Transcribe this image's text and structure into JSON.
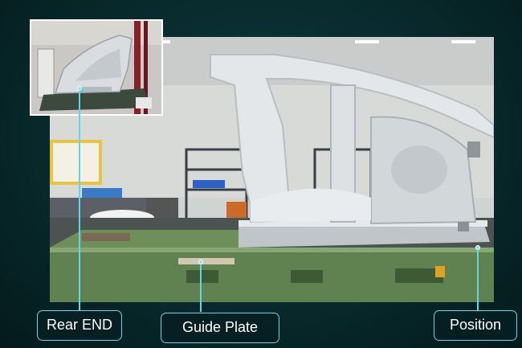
{
  "callouts": [
    {
      "label": "Rear END"
    },
    {
      "label": "Guide Plate"
    },
    {
      "label": "Position"
    }
  ],
  "colors": {
    "accent": "#5fd6e6",
    "background": "#082a2c",
    "label_text": "#ffffff"
  }
}
